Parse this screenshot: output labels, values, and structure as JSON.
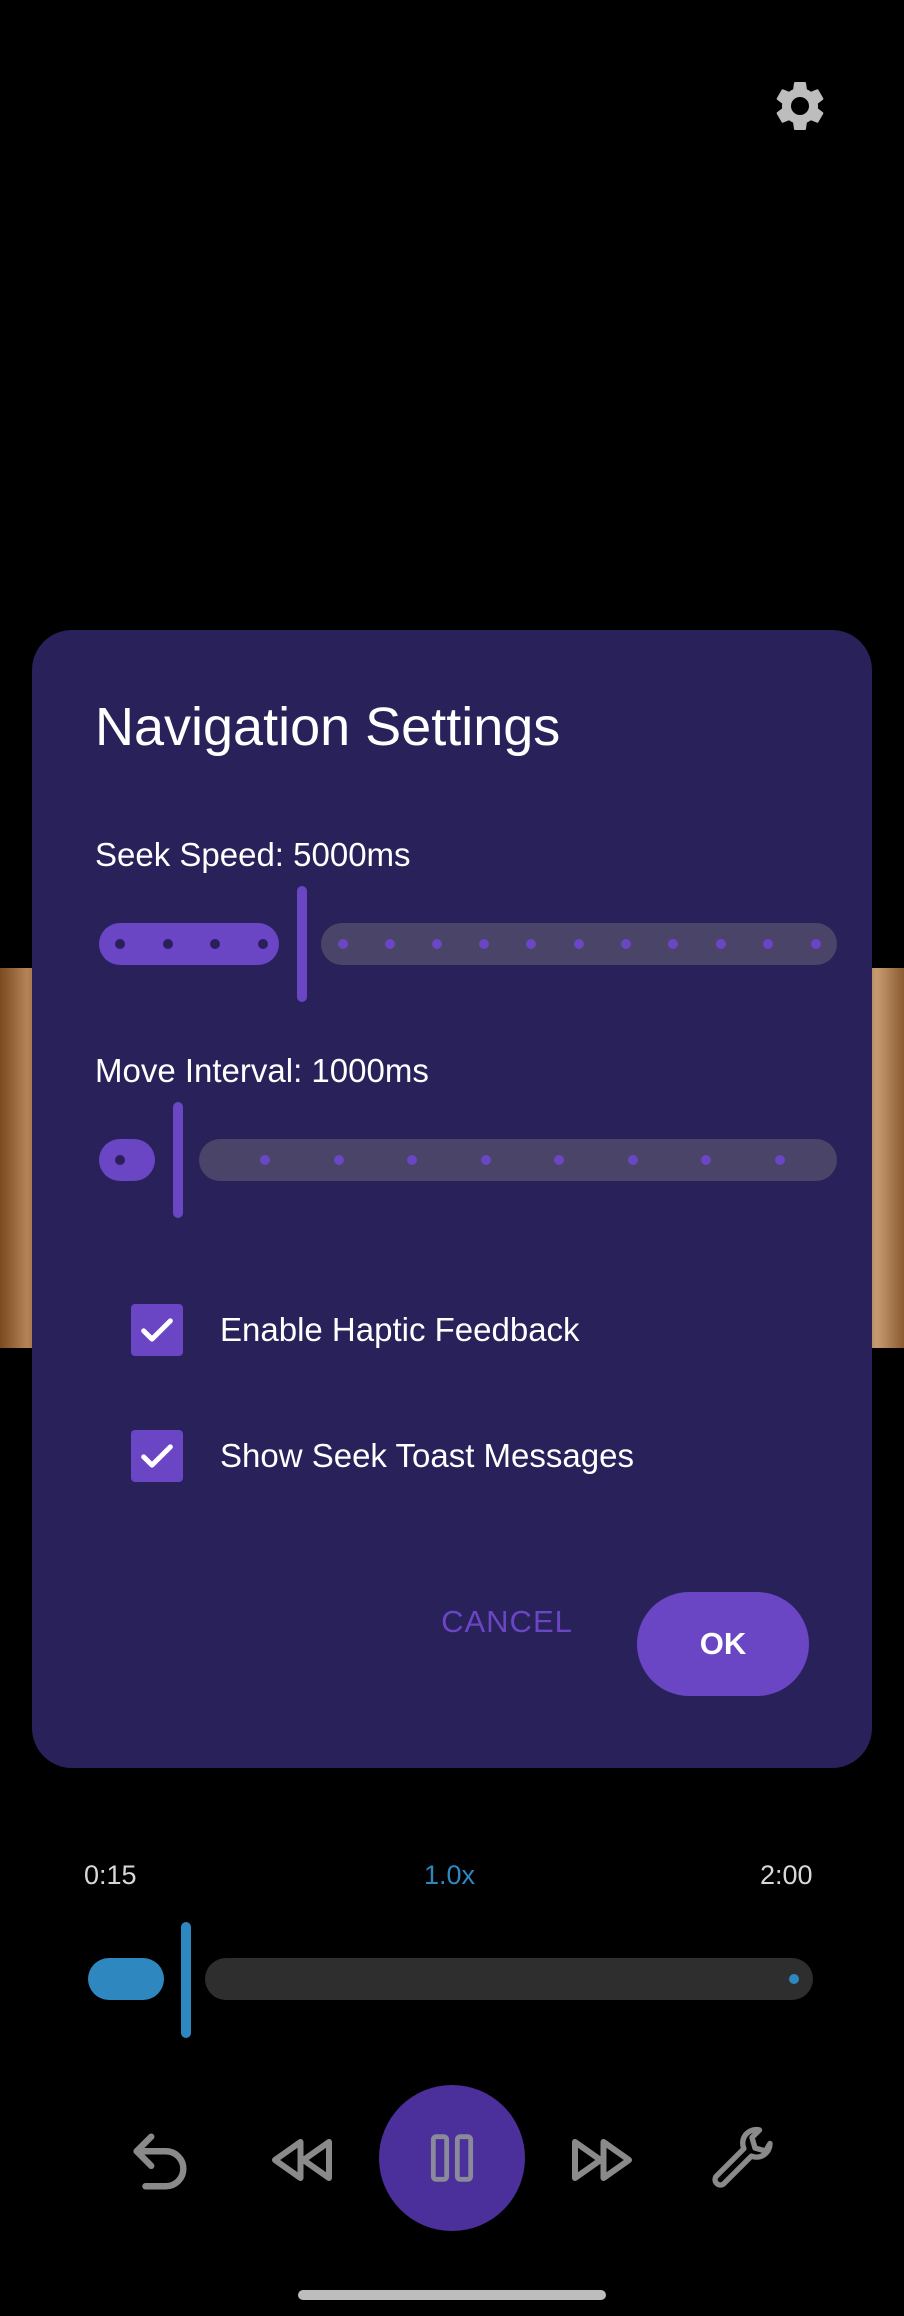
{
  "top_bar": {
    "settings_icon": "gear-icon"
  },
  "dialog": {
    "title": "Navigation Settings",
    "seek_speed": {
      "label": "Seek Speed: 5000ms",
      "value_ms": 5000,
      "position_fraction": 0.27
    },
    "move_interval": {
      "label": "Move Interval: 1000ms",
      "value_ms": 1000,
      "position_fraction": 0.1
    },
    "options": [
      {
        "label": "Enable Haptic Feedback",
        "checked": true
      },
      {
        "label": "Show Seek Toast Messages",
        "checked": true
      }
    ],
    "cancel_label": "CANCEL",
    "ok_label": "OK"
  },
  "player": {
    "current_time": "0:15",
    "speed": "1.0x",
    "total_time": "2:00",
    "progress_fraction": 0.125,
    "controls": [
      "undo-icon",
      "rewind-icon",
      "pause-icon",
      "fast-forward-icon",
      "wrench-icon"
    ]
  },
  "colors": {
    "dialog_bg": "#29215a",
    "accent": "#6a46c4",
    "player_accent": "#2f87c0"
  }
}
